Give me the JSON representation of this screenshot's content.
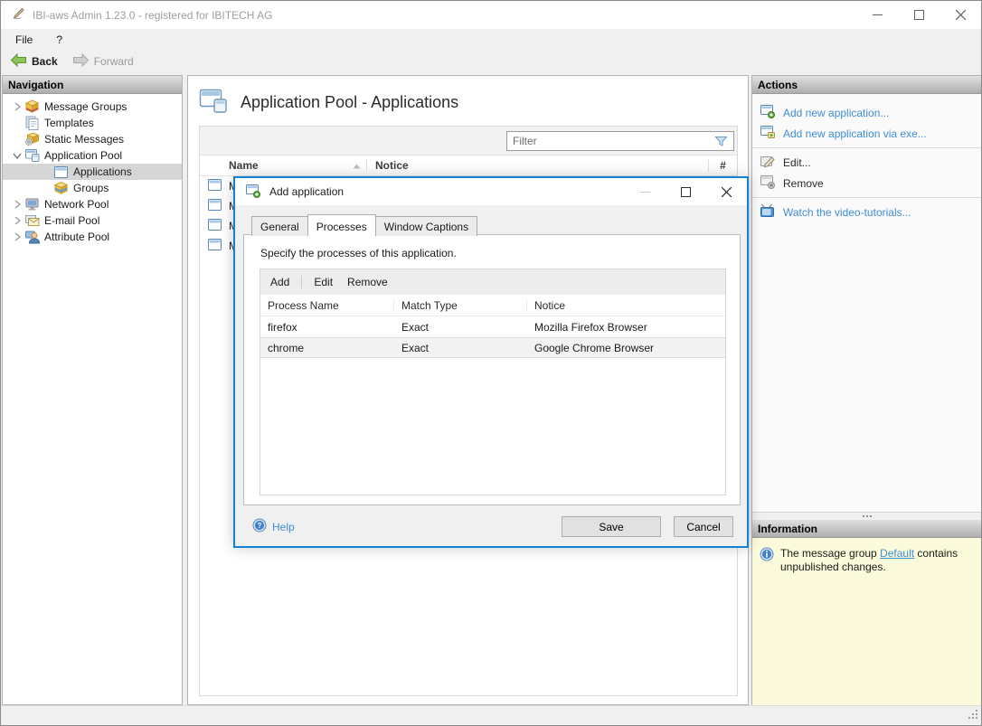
{
  "window": {
    "title": "IBI-aws Admin 1.23.0 - registered for IBITECH AG"
  },
  "menu": {
    "items": [
      {
        "label": "File"
      },
      {
        "label": "?"
      }
    ]
  },
  "toolbar": {
    "back_label": "Back",
    "forward_label": "Forward"
  },
  "navigation": {
    "header": "Navigation",
    "items": [
      {
        "label": "Message Groups"
      },
      {
        "label": "Templates"
      },
      {
        "label": "Static Messages"
      },
      {
        "label": "Application Pool"
      },
      {
        "label": "Applications"
      },
      {
        "label": "Groups"
      },
      {
        "label": "Network Pool"
      },
      {
        "label": "E-mail Pool"
      },
      {
        "label": "Attribute Pool"
      }
    ]
  },
  "main": {
    "title": "Application Pool - Applications",
    "filter_placeholder": "Filter",
    "table": {
      "columns": [
        "Name",
        "Notice",
        "#"
      ],
      "rows": [
        {
          "name": "M"
        },
        {
          "name": "M"
        },
        {
          "name": "M"
        },
        {
          "name": "M"
        }
      ]
    }
  },
  "actions": {
    "header": "Actions",
    "items": [
      {
        "label": "Add new application..."
      },
      {
        "label": "Add new application via exe..."
      },
      {
        "label": "Edit..."
      },
      {
        "label": "Remove"
      },
      {
        "label": "Watch the video-tutorials..."
      }
    ]
  },
  "information": {
    "header": "Information",
    "message_prefix": "The message group ",
    "link_text": "Default",
    "message_suffix": " contains unpublished changes."
  },
  "dialog": {
    "title": "Add application",
    "tabs": [
      {
        "label": "General"
      },
      {
        "label": "Processes"
      },
      {
        "label": "Window Captions"
      }
    ],
    "description": "Specify the processes of this application.",
    "toolbar": {
      "add": "Add",
      "edit": "Edit",
      "remove": "Remove"
    },
    "table": {
      "columns": [
        "Process Name",
        "Match Type",
        "Notice"
      ],
      "rows": [
        {
          "process_name": "firefox",
          "match_type": "Exact",
          "notice": "Mozilla Firefox Browser"
        },
        {
          "process_name": "chrome",
          "match_type": "Exact",
          "notice": "Google Chrome Browser"
        }
      ]
    },
    "help_label": "Help",
    "save_label": "Save",
    "cancel_label": "Cancel"
  },
  "colors": {
    "accent_blue": "#1581d2",
    "link_blue": "#3e8ed6",
    "info_bg": "#fbfbdc"
  }
}
